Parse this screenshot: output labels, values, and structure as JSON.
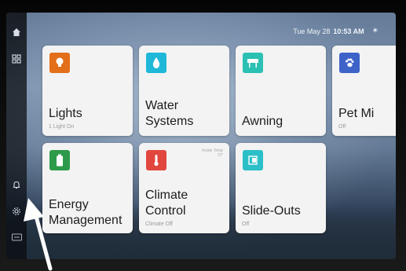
{
  "status": {
    "datetime_prefix": "Tue May 28",
    "time": "10:53 AM",
    "bluetooth_icon": "bluetooth-icon"
  },
  "rail": {
    "items": [
      {
        "name": "home-icon"
      },
      {
        "name": "grid-icon"
      },
      {
        "name": "bell-icon"
      },
      {
        "name": "gear-icon"
      },
      {
        "name": "keyboard-icon"
      }
    ]
  },
  "tiles": [
    {
      "label": "Lights",
      "sub": "1 Light On",
      "icon": "bulb-icon",
      "color": "#e36f1a"
    },
    {
      "label": "Water\nSystems",
      "sub": "",
      "icon": "water-drop-icon",
      "color": "#1fb8d8"
    },
    {
      "label": "Awning",
      "sub": "",
      "icon": "awning-icon",
      "color": "#2bc0b4"
    },
    {
      "label": "Pet Mi",
      "sub": "Off",
      "icon": "paw-icon",
      "color": "#3d63c9"
    },
    {
      "label": "Energy\nManagement",
      "sub": "",
      "icon": "battery-icon",
      "color": "#2e9b4a"
    },
    {
      "label": "Climate\nControl",
      "sub": "Climate Off",
      "corner": "Inside Temp\n72°",
      "icon": "thermometer-icon",
      "color": "#e2473e"
    },
    {
      "label": "Slide-Outs",
      "sub": "Off",
      "icon": "slide-out-icon",
      "color": "#2bbfc7"
    }
  ],
  "colors": {
    "tile_bg": "#f3f3f3",
    "label": "#1c1c1c",
    "sub": "#9a9a9a"
  }
}
